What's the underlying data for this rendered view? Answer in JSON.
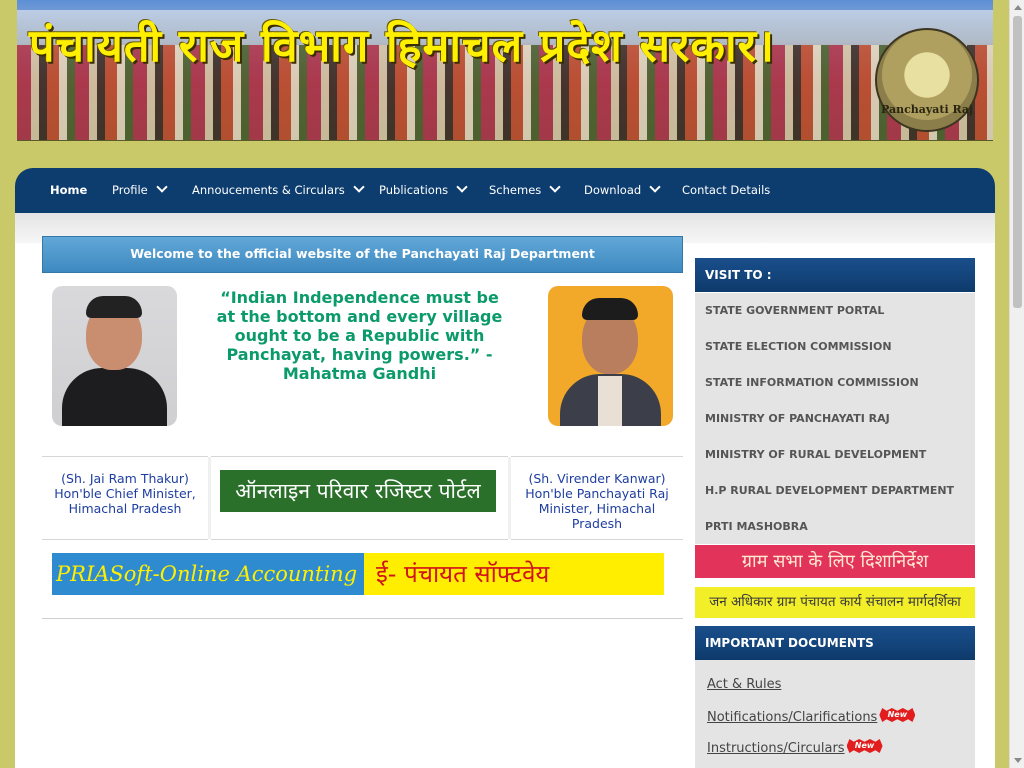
{
  "banner": {
    "title": "पंचायती राज विभाग हिमाचल प्रदेश सरकार।",
    "seal_text": "Panchayati Raj"
  },
  "nav": {
    "items": [
      {
        "label": "Home"
      },
      {
        "label": "Profile"
      },
      {
        "label": "Annoucements & Circulars"
      },
      {
        "label": "Publications"
      },
      {
        "label": "Schemes"
      },
      {
        "label": "Download"
      },
      {
        "label": "Contact Details"
      }
    ]
  },
  "main": {
    "welcome": "Welcome to the official website of the Panchayati Raj Department",
    "quote": "“Indian Independence must be at the bottom and every village ought to be a Republic with Panchayat, having powers.” - Mahatma Gandhi",
    "cm_caption": "(Sh. Jai Ram Thakur) Hon'ble Chief Minister, Himachal Pradesh",
    "minister_caption": "(Sh. Virender Kanwar) Hon'ble Panchayati Raj Minister, Himachal Pradesh",
    "register_portal": "ऑनलाइन परिवार रजिस्टर पोर्टल",
    "priasoft": "PRIASoft-Online Accounting S",
    "epanchayat": "ई- पंचायत सॉफ्टवेय"
  },
  "sidebar": {
    "visit_heading": "VISIT TO :",
    "visit_links": [
      {
        "label": "STATE GOVERNMENT PORTAL"
      },
      {
        "label": "STATE ELECTION COMMISSION"
      },
      {
        "label": "STATE INFORMATION COMMISSION"
      },
      {
        "label": "MINISTRY OF PANCHAYATI RAJ"
      },
      {
        "label": "MINISTRY OF RURAL DEVELOPMENT"
      },
      {
        "label": "H.P RURAL DEVELOPMENT DEPARTMENT"
      },
      {
        "label": "PRTI MASHOBRA"
      }
    ],
    "gram_sabha": "ग्राम सभा के लिए दिशानिर्देश",
    "jan_adhikar": "जन अधिकार ग्राम पंचायत कार्य संचालन मार्गदर्शिका",
    "docs_heading": "IMPORTANT DOCUMENTS",
    "doc_links": [
      {
        "label": "Act & Rules",
        "badge": ""
      },
      {
        "label": "Notifications/Clarifications",
        "badge": "New"
      },
      {
        "label": "Instructions/Circulars",
        "badge": "New"
      }
    ]
  }
}
